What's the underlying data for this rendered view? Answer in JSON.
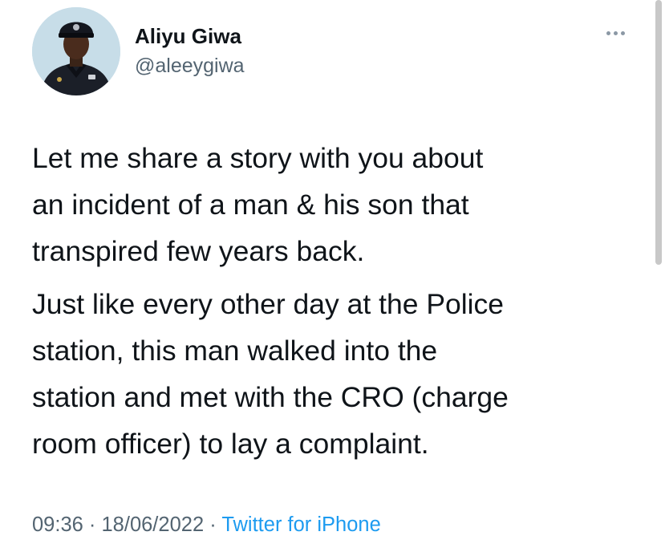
{
  "author": {
    "name": "Aliyu Giwa",
    "handle": "@aleeygiwa"
  },
  "tweet": {
    "paragraphs": [
      "Let me share a story with you about\nan incident of a man & his son that\ntranspired few years back.",
      "Just like every other day at the Police\nstation, this man walked into the\nstation and met with the CRO (charge\nroom officer) to lay a complaint."
    ]
  },
  "meta": {
    "time": "09:36",
    "separator": "·",
    "date": "18/06/2022",
    "source": "Twitter for iPhone"
  },
  "icons": {
    "more": "more-horizontal-icon"
  },
  "colors": {
    "text": "#0f1419",
    "secondary": "#536471",
    "link": "#1d9bf0"
  }
}
